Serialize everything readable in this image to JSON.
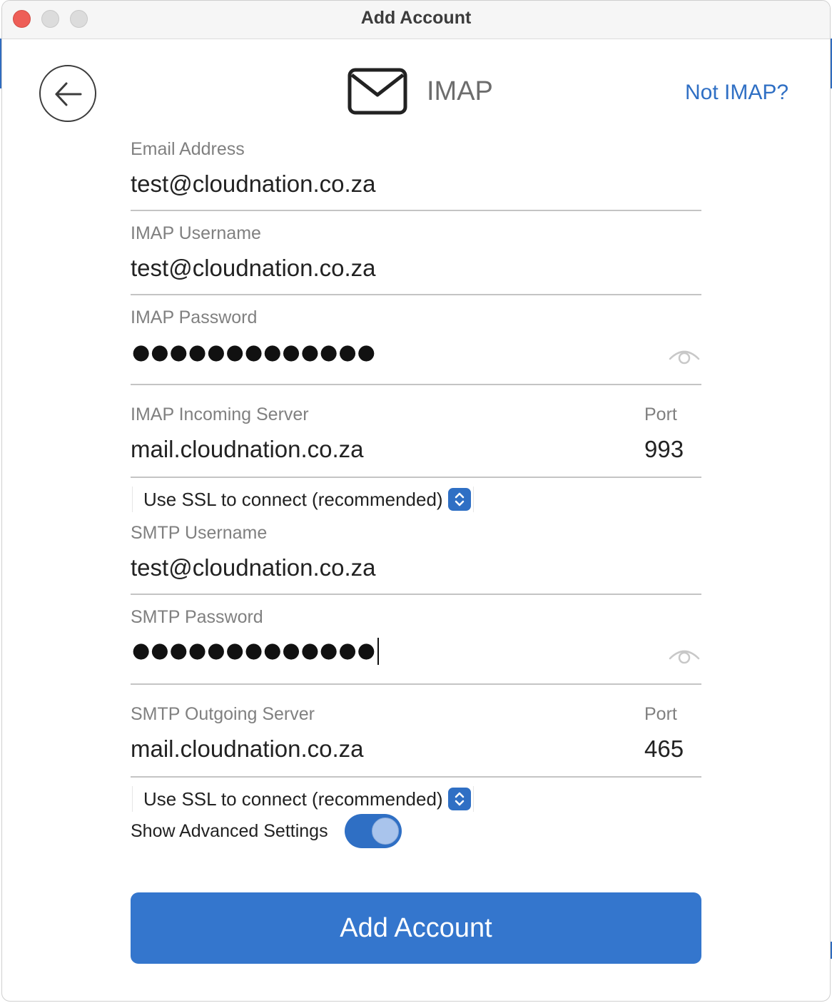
{
  "window": {
    "title": "Add Account"
  },
  "header": {
    "provider": "IMAP",
    "not_provider_link": "Not IMAP?"
  },
  "email": {
    "label": "Email Address",
    "value": "test@cloudnation.co.za"
  },
  "imap_username": {
    "label": "IMAP Username",
    "value": "test@cloudnation.co.za"
  },
  "imap_password": {
    "label": "IMAP Password",
    "masked": "●●●●●●●●●●●●●"
  },
  "imap_server": {
    "label": "IMAP Incoming Server",
    "value": "mail.cloudnation.co.za",
    "port_label": "Port",
    "port": "993",
    "ssl_option": "Use SSL to connect (recommended)"
  },
  "smtp_username": {
    "label": "SMTP Username",
    "value": "test@cloudnation.co.za"
  },
  "smtp_password": {
    "label": "SMTP Password",
    "masked": "●●●●●●●●●●●●●"
  },
  "smtp_server": {
    "label": "SMTP Outgoing Server",
    "value": "mail.cloudnation.co.za",
    "port_label": "Port",
    "port": "465",
    "ssl_option": "Use SSL to connect (recommended)"
  },
  "advanced": {
    "label": "Show Advanced Settings",
    "enabled": true
  },
  "actions": {
    "add_account": "Add Account"
  },
  "colors": {
    "accent": "#3476cd",
    "link": "#2f6fc4",
    "close": "#ee5e57"
  },
  "icons": {
    "back": "arrow-left-circle",
    "provider": "envelope",
    "reveal": "eye",
    "select": "chevron-up-down"
  }
}
